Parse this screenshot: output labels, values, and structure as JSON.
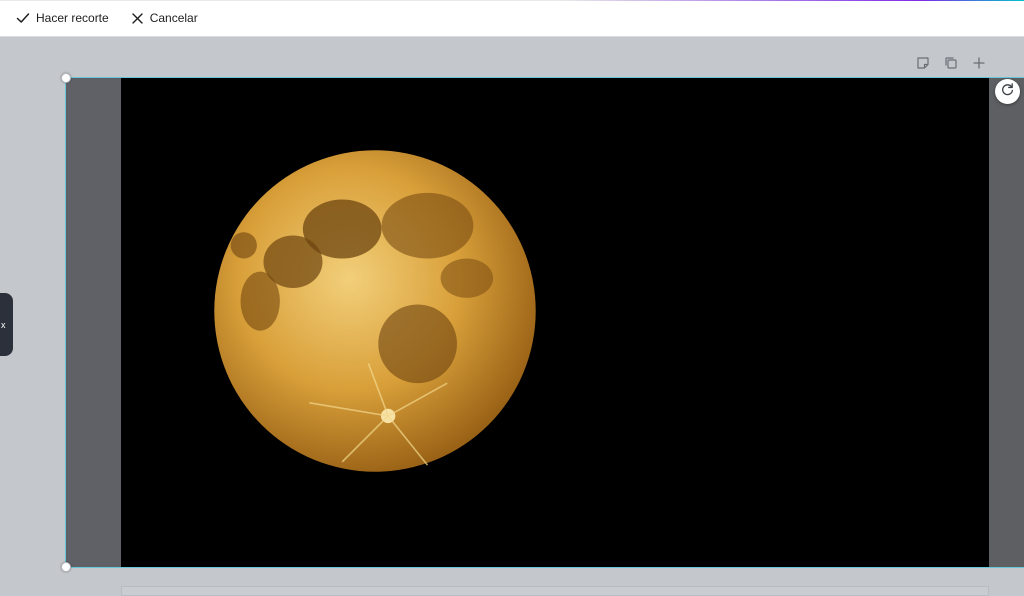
{
  "toolbar": {
    "done_label": "Hacer recorte",
    "cancel_label": "Cancelar",
    "done_icon": "check-icon",
    "cancel_icon": "close-icon"
  },
  "page_actions": {
    "icons": [
      "note-icon",
      "duplicate-page-icon",
      "add-page-icon"
    ]
  },
  "side_tab": {
    "label": "x"
  },
  "image": {
    "subject_icon": "moon-image",
    "background_color": "#000000"
  },
  "colors": {
    "crop_outline": "#67c7d6",
    "workspace": "#c4c7cb",
    "moon": "#d9a03a"
  }
}
